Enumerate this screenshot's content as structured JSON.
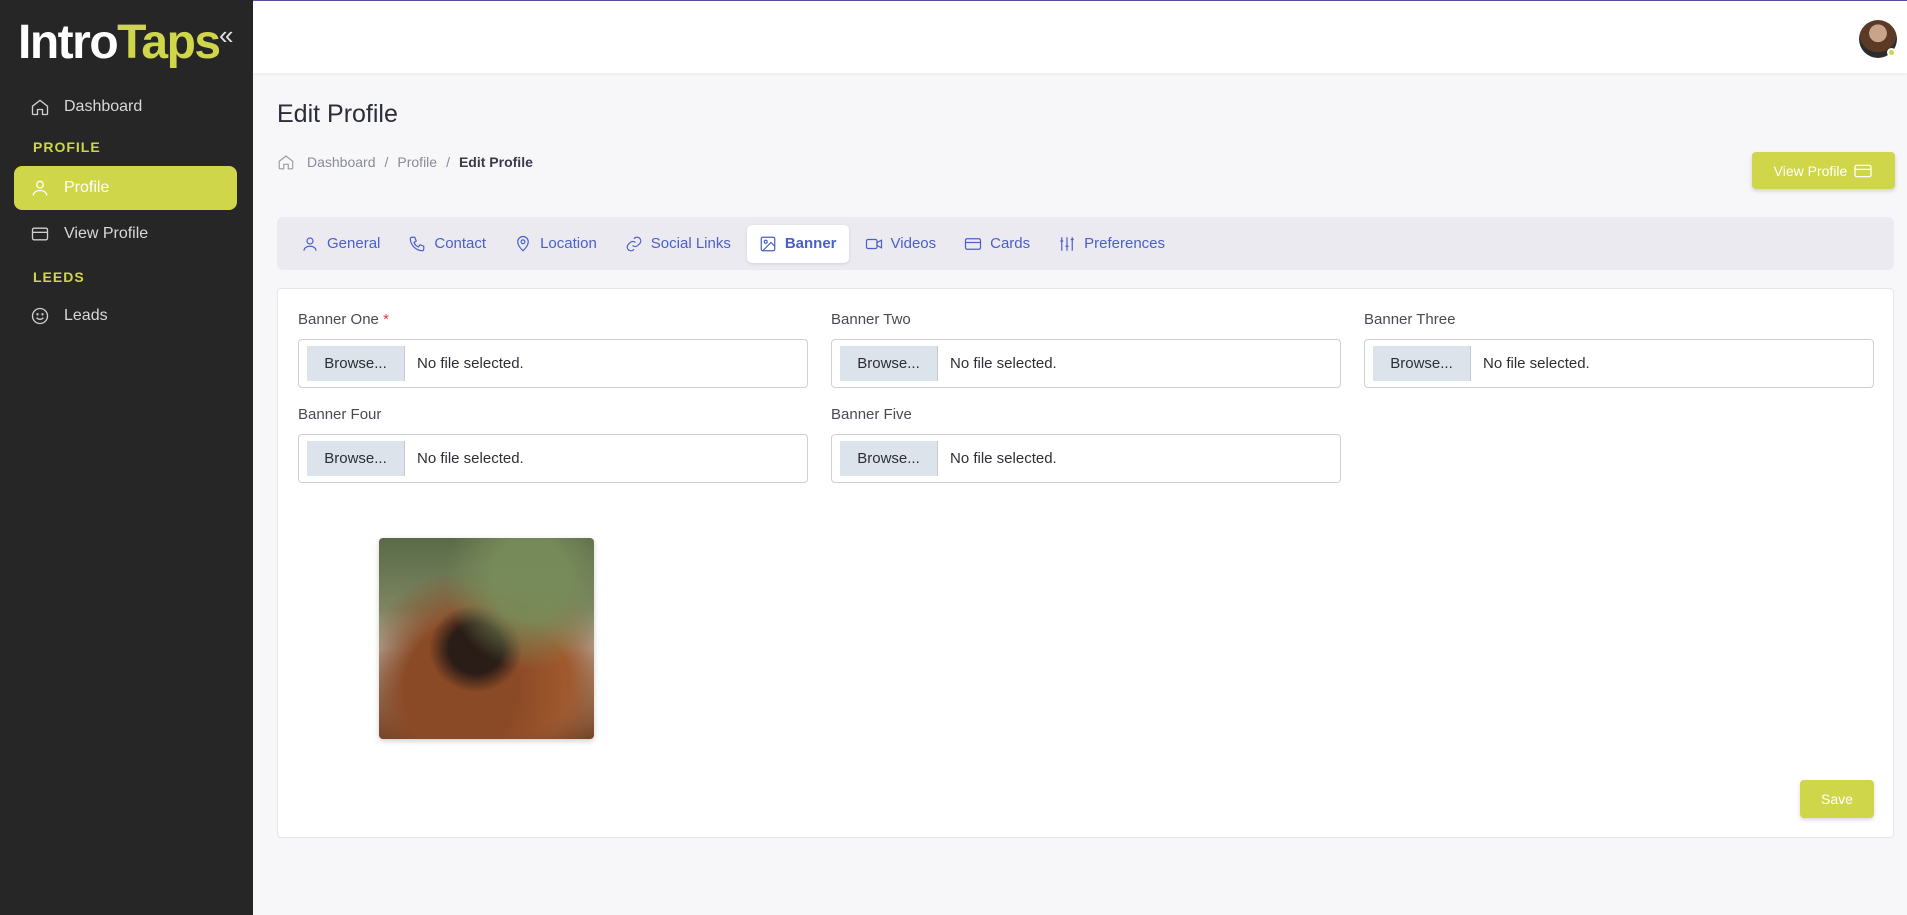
{
  "logo": {
    "part1": "Intro",
    "part2": "Taps"
  },
  "sidebar": {
    "collapse_glyph": "«",
    "items": [
      {
        "label": "Dashboard",
        "icon": "home-icon",
        "active": false
      },
      {
        "label": "Profile",
        "icon": "user-icon",
        "active": true
      },
      {
        "label": "View Profile",
        "icon": "card-icon",
        "active": false
      },
      {
        "label": "Leads",
        "icon": "smiley-icon",
        "active": false
      }
    ],
    "sections": [
      "PROFILE",
      "LEEDS"
    ]
  },
  "header": {
    "title": "Edit Profile"
  },
  "breadcrumb": {
    "items": [
      "Dashboard",
      "Profile",
      "Edit Profile"
    ],
    "separator": "/"
  },
  "view_profile_button": "View Profile",
  "tabs": [
    {
      "label": "General",
      "icon": "user-icon"
    },
    {
      "label": "Contact",
      "icon": "phone-icon"
    },
    {
      "label": "Location",
      "icon": "location-pin-icon"
    },
    {
      "label": "Social Links",
      "icon": "link-icon"
    },
    {
      "label": "Banner",
      "icon": "image-icon",
      "active": true
    },
    {
      "label": "Videos",
      "icon": "video-icon"
    },
    {
      "label": "Cards",
      "icon": "card-icon"
    },
    {
      "label": "Preferences",
      "icon": "sliders-icon"
    }
  ],
  "banner_fields": [
    {
      "label": "Banner One",
      "required": "*",
      "button": "Browse...",
      "status": "No file selected."
    },
    {
      "label": "Banner Two",
      "button": "Browse...",
      "status": "No file selected."
    },
    {
      "label": "Banner Three",
      "button": "Browse...",
      "status": "No file selected."
    },
    {
      "label": "Banner Four",
      "button": "Browse...",
      "status": "No file selected."
    },
    {
      "label": "Banner Five",
      "button": "Browse...",
      "status": "No file selected."
    }
  ],
  "save_button": "Save",
  "colors": {
    "accent": "#cfd64a",
    "sidebar_bg": "#262626",
    "tab_text": "#4a5fc8"
  }
}
